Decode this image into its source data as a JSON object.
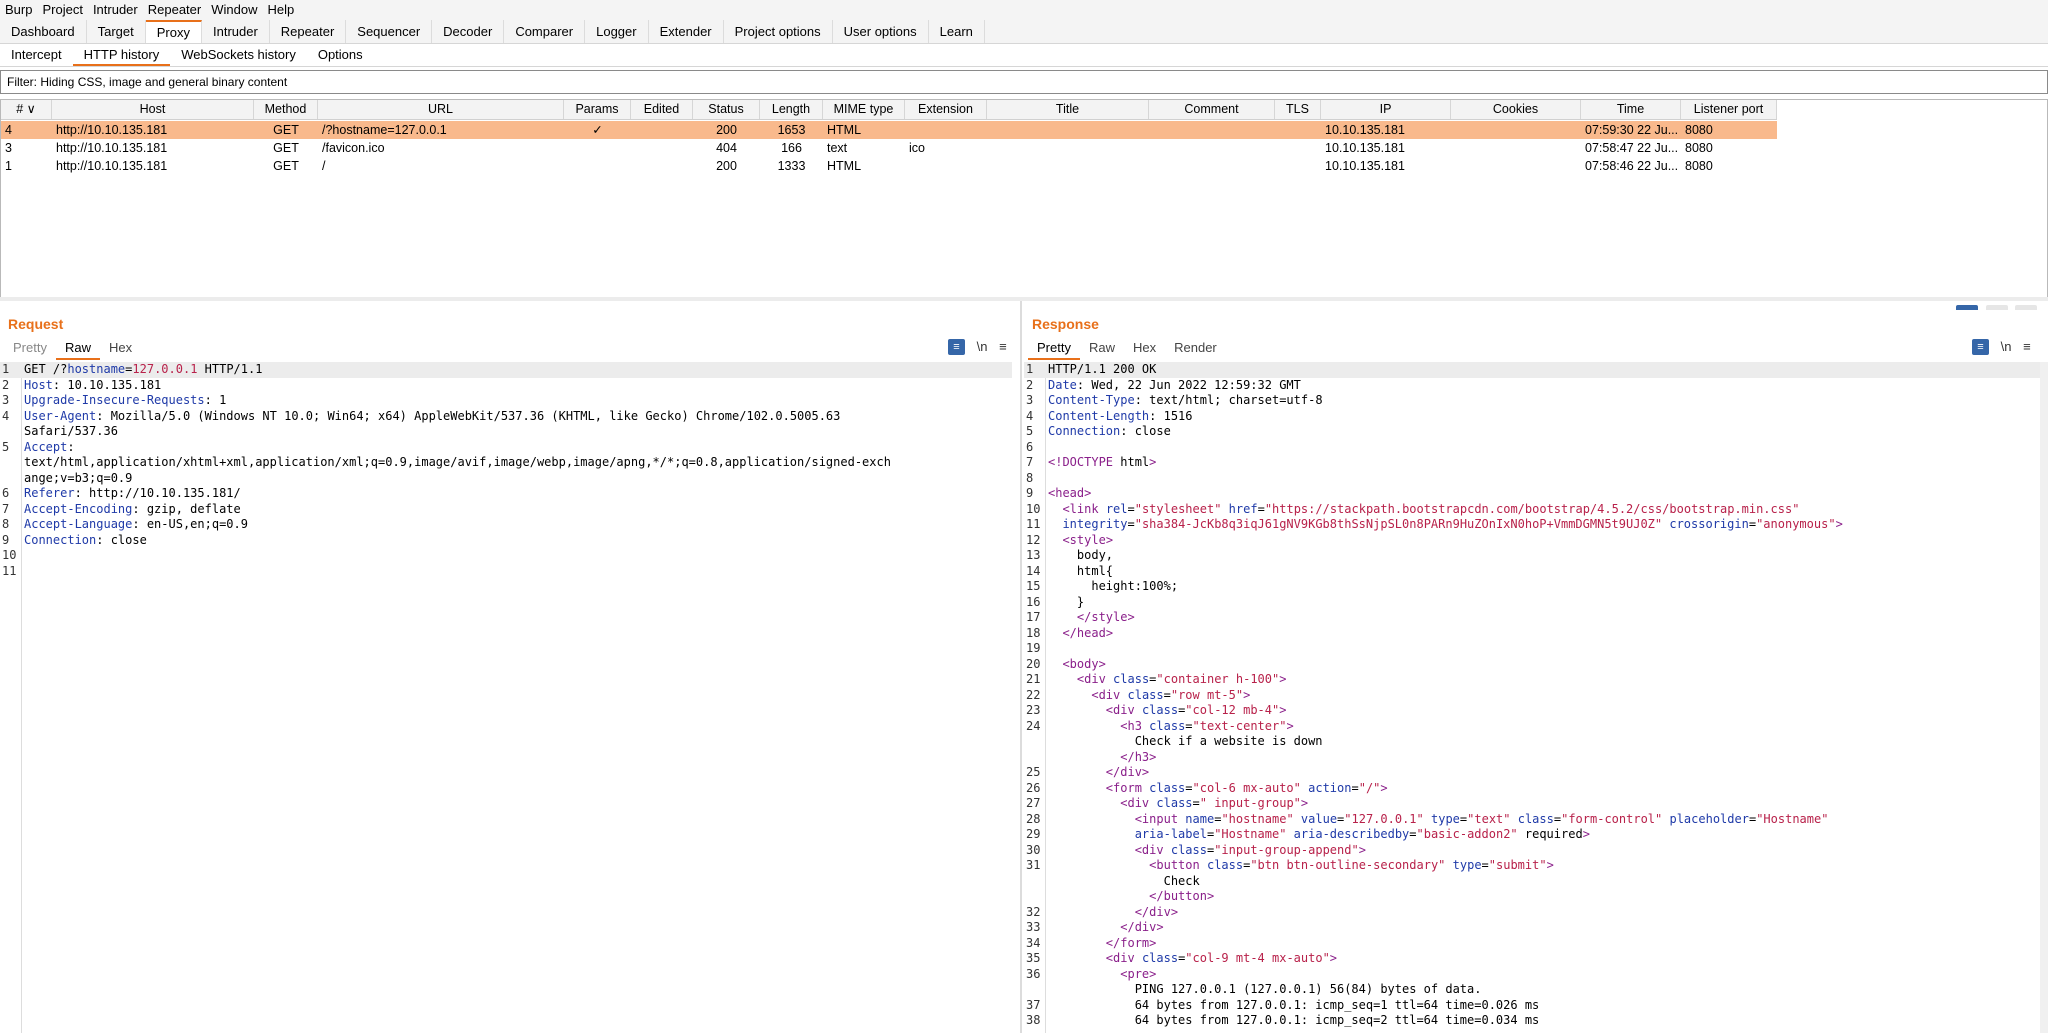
{
  "menu": [
    "Burp",
    "Project",
    "Intruder",
    "Repeater",
    "Window",
    "Help"
  ],
  "main_tabs": [
    "Dashboard",
    "Target",
    "Proxy",
    "Intruder",
    "Repeater",
    "Sequencer",
    "Decoder",
    "Comparer",
    "Logger",
    "Extender",
    "Project options",
    "User options",
    "Learn"
  ],
  "sub_tabs": [
    "Intercept",
    "HTTP history",
    "WebSockets history",
    "Options"
  ],
  "filter": "Filter: Hiding CSS, image and general binary content",
  "table": {
    "headers": [
      "#",
      "Host",
      "Method",
      "URL",
      "Params",
      "Edited",
      "Status",
      "Length",
      "MIME type",
      "Extension",
      "Title",
      "Comment",
      "TLS",
      "IP",
      "Cookies",
      "Time",
      "Listener port"
    ],
    "rows": [
      {
        "num": "4",
        "host": "http://10.10.135.181",
        "method": "GET",
        "url": "/?hostname=127.0.0.1",
        "params": "✓",
        "edited": "",
        "status": "200",
        "length": "1653",
        "mime": "HTML",
        "ext": "",
        "title": "",
        "comment": "",
        "tls": "",
        "ip": "10.10.135.181",
        "cookies": "",
        "time": "07:59:30 22 Ju...",
        "port": "8080"
      },
      {
        "num": "3",
        "host": "http://10.10.135.181",
        "method": "GET",
        "url": "/favicon.ico",
        "params": "",
        "edited": "",
        "status": "404",
        "length": "166",
        "mime": "text",
        "ext": "ico",
        "title": "",
        "comment": "",
        "tls": "",
        "ip": "10.10.135.181",
        "cookies": "",
        "time": "07:58:47 22 Ju...",
        "port": "8080"
      },
      {
        "num": "1",
        "host": "http://10.10.135.181",
        "method": "GET",
        "url": "/",
        "params": "",
        "edited": "",
        "status": "200",
        "length": "1333",
        "mime": "HTML",
        "ext": "",
        "title": "",
        "comment": "",
        "tls": "",
        "ip": "10.10.135.181",
        "cookies": "",
        "time": "07:58:46 22 Ju...",
        "port": "8080"
      }
    ]
  },
  "request": {
    "title": "Request",
    "tabs": [
      "Pretty",
      "Raw",
      "Hex"
    ],
    "lines": [
      {
        "n": "1",
        "t": "GET /?hostname=127.0.0.1 HTTP/1.1"
      },
      {
        "n": "2",
        "t": "Host: 10.10.135.181"
      },
      {
        "n": "3",
        "t": "Upgrade-Insecure-Requests: 1"
      },
      {
        "n": "4",
        "t": "User-Agent: Mozilla/5.0 (Windows NT 10.0; Win64; x64) AppleWebKit/537.36 (KHTML, like Gecko) Chrome/102.0.5005.63"
      },
      {
        "n": "",
        "t": "Safari/537.36"
      },
      {
        "n": "5",
        "t": "Accept:"
      },
      {
        "n": "",
        "t": "text/html,application/xhtml+xml,application/xml;q=0.9,image/avif,image/webp,image/apng,*/*;q=0.8,application/signed-exch"
      },
      {
        "n": "",
        "t": "ange;v=b3;q=0.9"
      },
      {
        "n": "6",
        "t": "Referer: http://10.10.135.181/"
      },
      {
        "n": "7",
        "t": "Accept-Encoding: gzip, deflate"
      },
      {
        "n": "8",
        "t": "Accept-Language: en-US,en;q=0.9"
      },
      {
        "n": "9",
        "t": "Connection: close"
      },
      {
        "n": "10",
        "t": ""
      },
      {
        "n": "11",
        "t": ""
      }
    ]
  },
  "response": {
    "title": "Response",
    "tabs": [
      "Pretty",
      "Raw",
      "Hex",
      "Render"
    ],
    "lines": [
      {
        "n": "1",
        "t": "HTTP/1.1 200 OK"
      },
      {
        "n": "2",
        "t": "Date: Wed, 22 Jun 2022 12:59:32 GMT"
      },
      {
        "n": "3",
        "t": "Content-Type: text/html; charset=utf-8"
      },
      {
        "n": "4",
        "t": "Content-Length: 1516"
      },
      {
        "n": "5",
        "t": "Connection: close"
      },
      {
        "n": "6",
        "t": ""
      },
      {
        "n": "7",
        "t": "<!DOCTYPE html>"
      },
      {
        "n": "8",
        "t": ""
      },
      {
        "n": "9",
        "t": "<head>"
      },
      {
        "n": "10",
        "t": "  <link rel=\"stylesheet\" href=\"https://stackpath.bootstrapcdn.com/bootstrap/4.5.2/css/bootstrap.min.css\""
      },
      {
        "n": "11",
        "t": "  integrity=\"sha384-JcKb8q3iqJ61gNV9KGb8thSsNjpSL0n8PARn9HuZOnIxN0hoP+VmmDGMN5t9UJ0Z\" crossorigin=\"anonymous\">"
      },
      {
        "n": "12",
        "t": "  <style>"
      },
      {
        "n": "13",
        "t": "    body,"
      },
      {
        "n": "14",
        "t": "    html{"
      },
      {
        "n": "15",
        "t": "      height:100%;"
      },
      {
        "n": "16",
        "t": "    }"
      },
      {
        "n": "17",
        "t": "    </style>"
      },
      {
        "n": "18",
        "t": "  </head>"
      },
      {
        "n": "19",
        "t": ""
      },
      {
        "n": "20",
        "t": "  <body>"
      },
      {
        "n": "21",
        "t": "    <div class=\"container h-100\">"
      },
      {
        "n": "22",
        "t": "      <div class=\"row mt-5\">"
      },
      {
        "n": "23",
        "t": "        <div class=\"col-12 mb-4\">"
      },
      {
        "n": "24",
        "t": "          <h3 class=\"text-center\">"
      },
      {
        "n": "",
        "t": "            Check if a website is down"
      },
      {
        "n": "",
        "t": "          </h3>"
      },
      {
        "n": "25",
        "t": "        </div>"
      },
      {
        "n": "26",
        "t": "        <form class=\"col-6 mx-auto\" action=\"/\">"
      },
      {
        "n": "27",
        "t": "          <div class=\" input-group\">"
      },
      {
        "n": "28",
        "t": "            <input name=\"hostname\" value=\"127.0.0.1\" type=\"text\" class=\"form-control\" placeholder=\"Hostname\""
      },
      {
        "n": "29",
        "t": "            aria-label=\"Hostname\" aria-describedby=\"basic-addon2\" required>"
      },
      {
        "n": "30",
        "t": "            <div class=\"input-group-append\">"
      },
      {
        "n": "31",
        "t": "              <button class=\"btn btn-outline-secondary\" type=\"submit\">"
      },
      {
        "n": "",
        "t": "                Check"
      },
      {
        "n": "",
        "t": "              </button>"
      },
      {
        "n": "32",
        "t": "            </div>"
      },
      {
        "n": "33",
        "t": "          </div>"
      },
      {
        "n": "34",
        "t": "        </form>"
      },
      {
        "n": "35",
        "t": "        <div class=\"col-9 mt-4 mx-auto\">"
      },
      {
        "n": "36",
        "t": "          <pre>"
      },
      {
        "n": "",
        "t": "            PING 127.0.0.1 (127.0.0.1) 56(84) bytes of data."
      },
      {
        "n": "37",
        "t": "            64 bytes from 127.0.0.1: icmp_seq=1 ttl=64 time=0.026 ms"
      },
      {
        "n": "38",
        "t": "            64 bytes from 127.0.0.1: icmp_seq=2 ttl=64 time=0.034 ms"
      }
    ]
  }
}
